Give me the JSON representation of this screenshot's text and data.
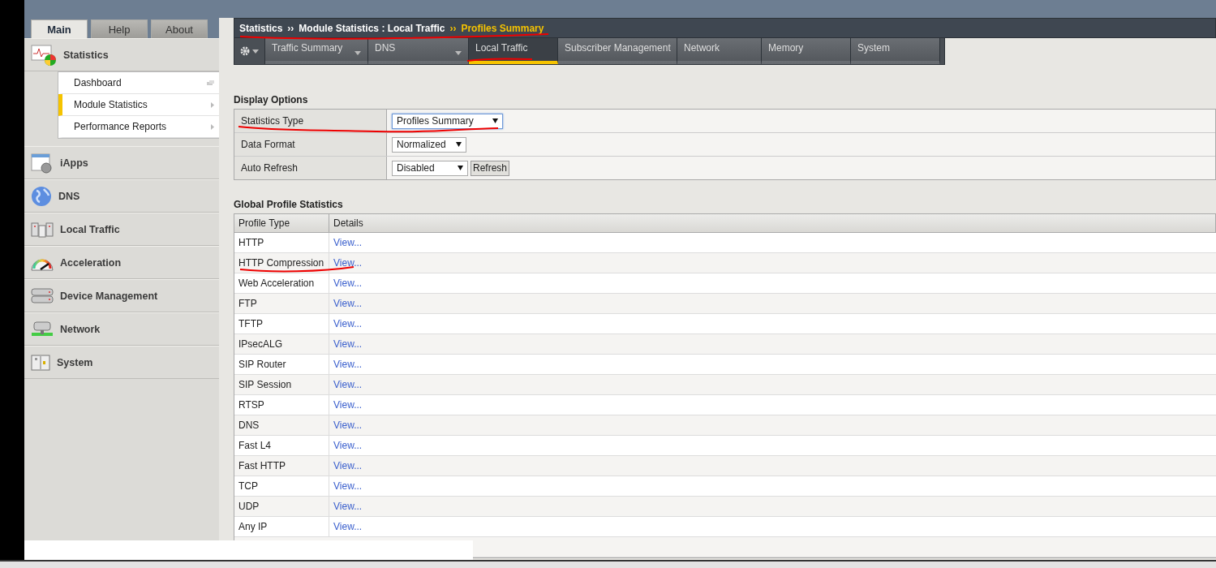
{
  "top_tabs": [
    {
      "label": "Main",
      "selected": true
    },
    {
      "label": "Help",
      "selected": false
    },
    {
      "label": "About",
      "selected": false
    }
  ],
  "sidebar": {
    "items": [
      {
        "label": "Statistics",
        "children": [
          {
            "label": "Dashboard",
            "selected": false
          },
          {
            "label": "Module Statistics",
            "selected": true
          },
          {
            "label": "Performance Reports",
            "selected": false
          }
        ]
      },
      {
        "label": "iApps"
      },
      {
        "label": "DNS"
      },
      {
        "label": "Local Traffic"
      },
      {
        "label": "Acceleration"
      },
      {
        "label": "Device Management"
      },
      {
        "label": "Network"
      },
      {
        "label": "System"
      }
    ]
  },
  "breadcrumb": [
    {
      "label": "Statistics",
      "current": false
    },
    {
      "separator": "››",
      "label": "Module Statistics : Local Traffic",
      "current": false
    },
    {
      "separator": "››",
      "label": "Profiles Summary",
      "current": true
    }
  ],
  "nav_tabs": [
    {
      "label": "Traffic Summary",
      "selected": false,
      "dropdown": true
    },
    {
      "label": "DNS",
      "selected": false,
      "dropdown": true
    },
    {
      "label": "Local Traffic",
      "selected": true,
      "dropdown": false
    },
    {
      "label": "Subscriber Management",
      "selected": false,
      "dropdown": false
    },
    {
      "label": "Network",
      "selected": false,
      "dropdown": false
    },
    {
      "label": "Memory",
      "selected": false,
      "dropdown": false
    },
    {
      "label": "System",
      "selected": false,
      "dropdown": false
    }
  ],
  "display_options": {
    "title": "Display Options",
    "rows": [
      {
        "label": "Statistics Type",
        "value": "Profiles Summary",
        "focused": true
      },
      {
        "label": "Data Format",
        "value": "Normalized",
        "focused": false
      },
      {
        "label": "Auto Refresh",
        "value": "Disabled",
        "focused": false,
        "button": "Refresh"
      }
    ]
  },
  "global_profile_statistics": {
    "title": "Global Profile Statistics",
    "columns": [
      "Profile Type",
      "Details"
    ],
    "rows": [
      {
        "profile_type": "HTTP",
        "details": "View..."
      },
      {
        "profile_type": "HTTP Compression",
        "details": "View..."
      },
      {
        "profile_type": "Web Acceleration",
        "details": "View..."
      },
      {
        "profile_type": "FTP",
        "details": "View..."
      },
      {
        "profile_type": "TFTP",
        "details": "View..."
      },
      {
        "profile_type": "IPsecALG",
        "details": "View..."
      },
      {
        "profile_type": "SIP Router",
        "details": "View..."
      },
      {
        "profile_type": "SIP Session",
        "details": "View..."
      },
      {
        "profile_type": "RTSP",
        "details": "View..."
      },
      {
        "profile_type": "DNS",
        "details": "View..."
      },
      {
        "profile_type": "Fast L4",
        "details": "View..."
      },
      {
        "profile_type": "Fast HTTP",
        "details": "View..."
      },
      {
        "profile_type": "TCP",
        "details": "View..."
      },
      {
        "profile_type": "UDP",
        "details": "View..."
      },
      {
        "profile_type": "Any IP",
        "details": "View..."
      }
    ]
  }
}
